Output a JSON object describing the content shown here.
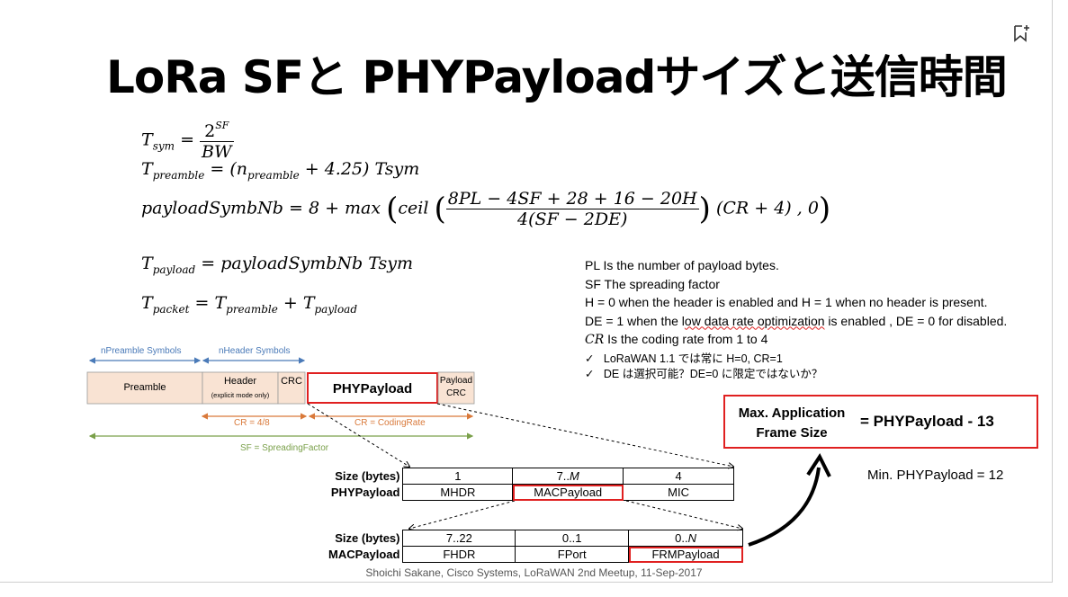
{
  "title": "LoRa SFと PHYPayloadサイズと送信時間",
  "formulas": {
    "tsym_lhs": "T",
    "tsym_sub": "sym",
    "tsym_num_base": "2",
    "tsym_num_sup": "SF",
    "tsym_den": "BW",
    "tpre_lhs": "T",
    "tpre_sub": "preamble",
    "tpre_rhs_a": "= (n",
    "tpre_rhs_sub": "preamble",
    "tpre_rhs_b": " + 4.25) Tsym",
    "psn_lhs": "payloadSymbNb = 8 + max",
    "psn_ceil": "ceil",
    "psn_num": "8PL − 4SF + 28 + 16 − 20H",
    "psn_den": "4(SF − 2DE)",
    "psn_tail": "(CR + 4) , 0",
    "tpay_lhs": "T",
    "tpay_sub": "payload",
    "tpay_rhs": "= payloadSymbNb  Tsym",
    "tpkt_lhs": "T",
    "tpkt_sub": "packet",
    "tpkt_eq": "= T",
    "tpkt_sub2": "preamble",
    "tpkt_plus": " + T",
    "tpkt_sub3": "payload"
  },
  "definitions": {
    "pl": "PL Is the number of payload bytes.",
    "sf": "SF The spreading factor",
    "h": "H = 0 when the header is enabled and H = 1 when no header is present.",
    "de_a": "DE = 1 when the l",
    "de_b": "ow data rate optimization",
    "de_c": " is enabled , DE  = 0 for disabled.",
    "cr_sym": "CR",
    "cr": " Is the coding rate from 1 to 4",
    "note1": "LoRaWAN 1.1 では常に H=0, CR=1",
    "note2": "DE は選択可能？DE=0 に限定ではないか？",
    "check": "✓"
  },
  "diagram": {
    "npreamble": "nPreamble Symbols",
    "nheader": "nHeader Symbols",
    "preamble": "Preamble",
    "header": "Header",
    "header_note": "(explicit mode only)",
    "crc": "CRC",
    "phypayload": "PHYPayload",
    "payload_crc1": "Payload",
    "payload_crc2": "CRC",
    "cr48": "CR = 4/8",
    "cr_coding": "CR = CodingRate",
    "sf_label": "SF = SpreadingFactor"
  },
  "phy_table": {
    "h1": "Size (bytes)",
    "h2": "PHYPayload",
    "c1": "1",
    "c2a": "7..",
    "c2b": "M",
    "c3": "4",
    "f1": "MHDR",
    "f2": "MACPayload",
    "f3": "MIC"
  },
  "mac_table": {
    "h1": "Size (bytes)",
    "h2": "MACPayload",
    "c1": "7..22",
    "c2": "0..1",
    "c3a": "0..",
    "c3b": "N",
    "f1": "FHDR",
    "f2": "FPort",
    "f3": "FRMPayload"
  },
  "maxbox": {
    "label1": "Max. Application",
    "label2": "Frame Size",
    "value": "= PHYPayload - 13"
  },
  "min_phy": "Min. PHYPayload = 12",
  "footer": "Shoichi Sakane, Cisco Systems, LoRaWAN 2nd Meetup, 11-Sep-2017",
  "colors": {
    "accent_red": "#e02020",
    "blue": "#4a7ab8",
    "orange": "#d9793a",
    "green": "#7aa04a",
    "peach": "#f9e3d3"
  }
}
